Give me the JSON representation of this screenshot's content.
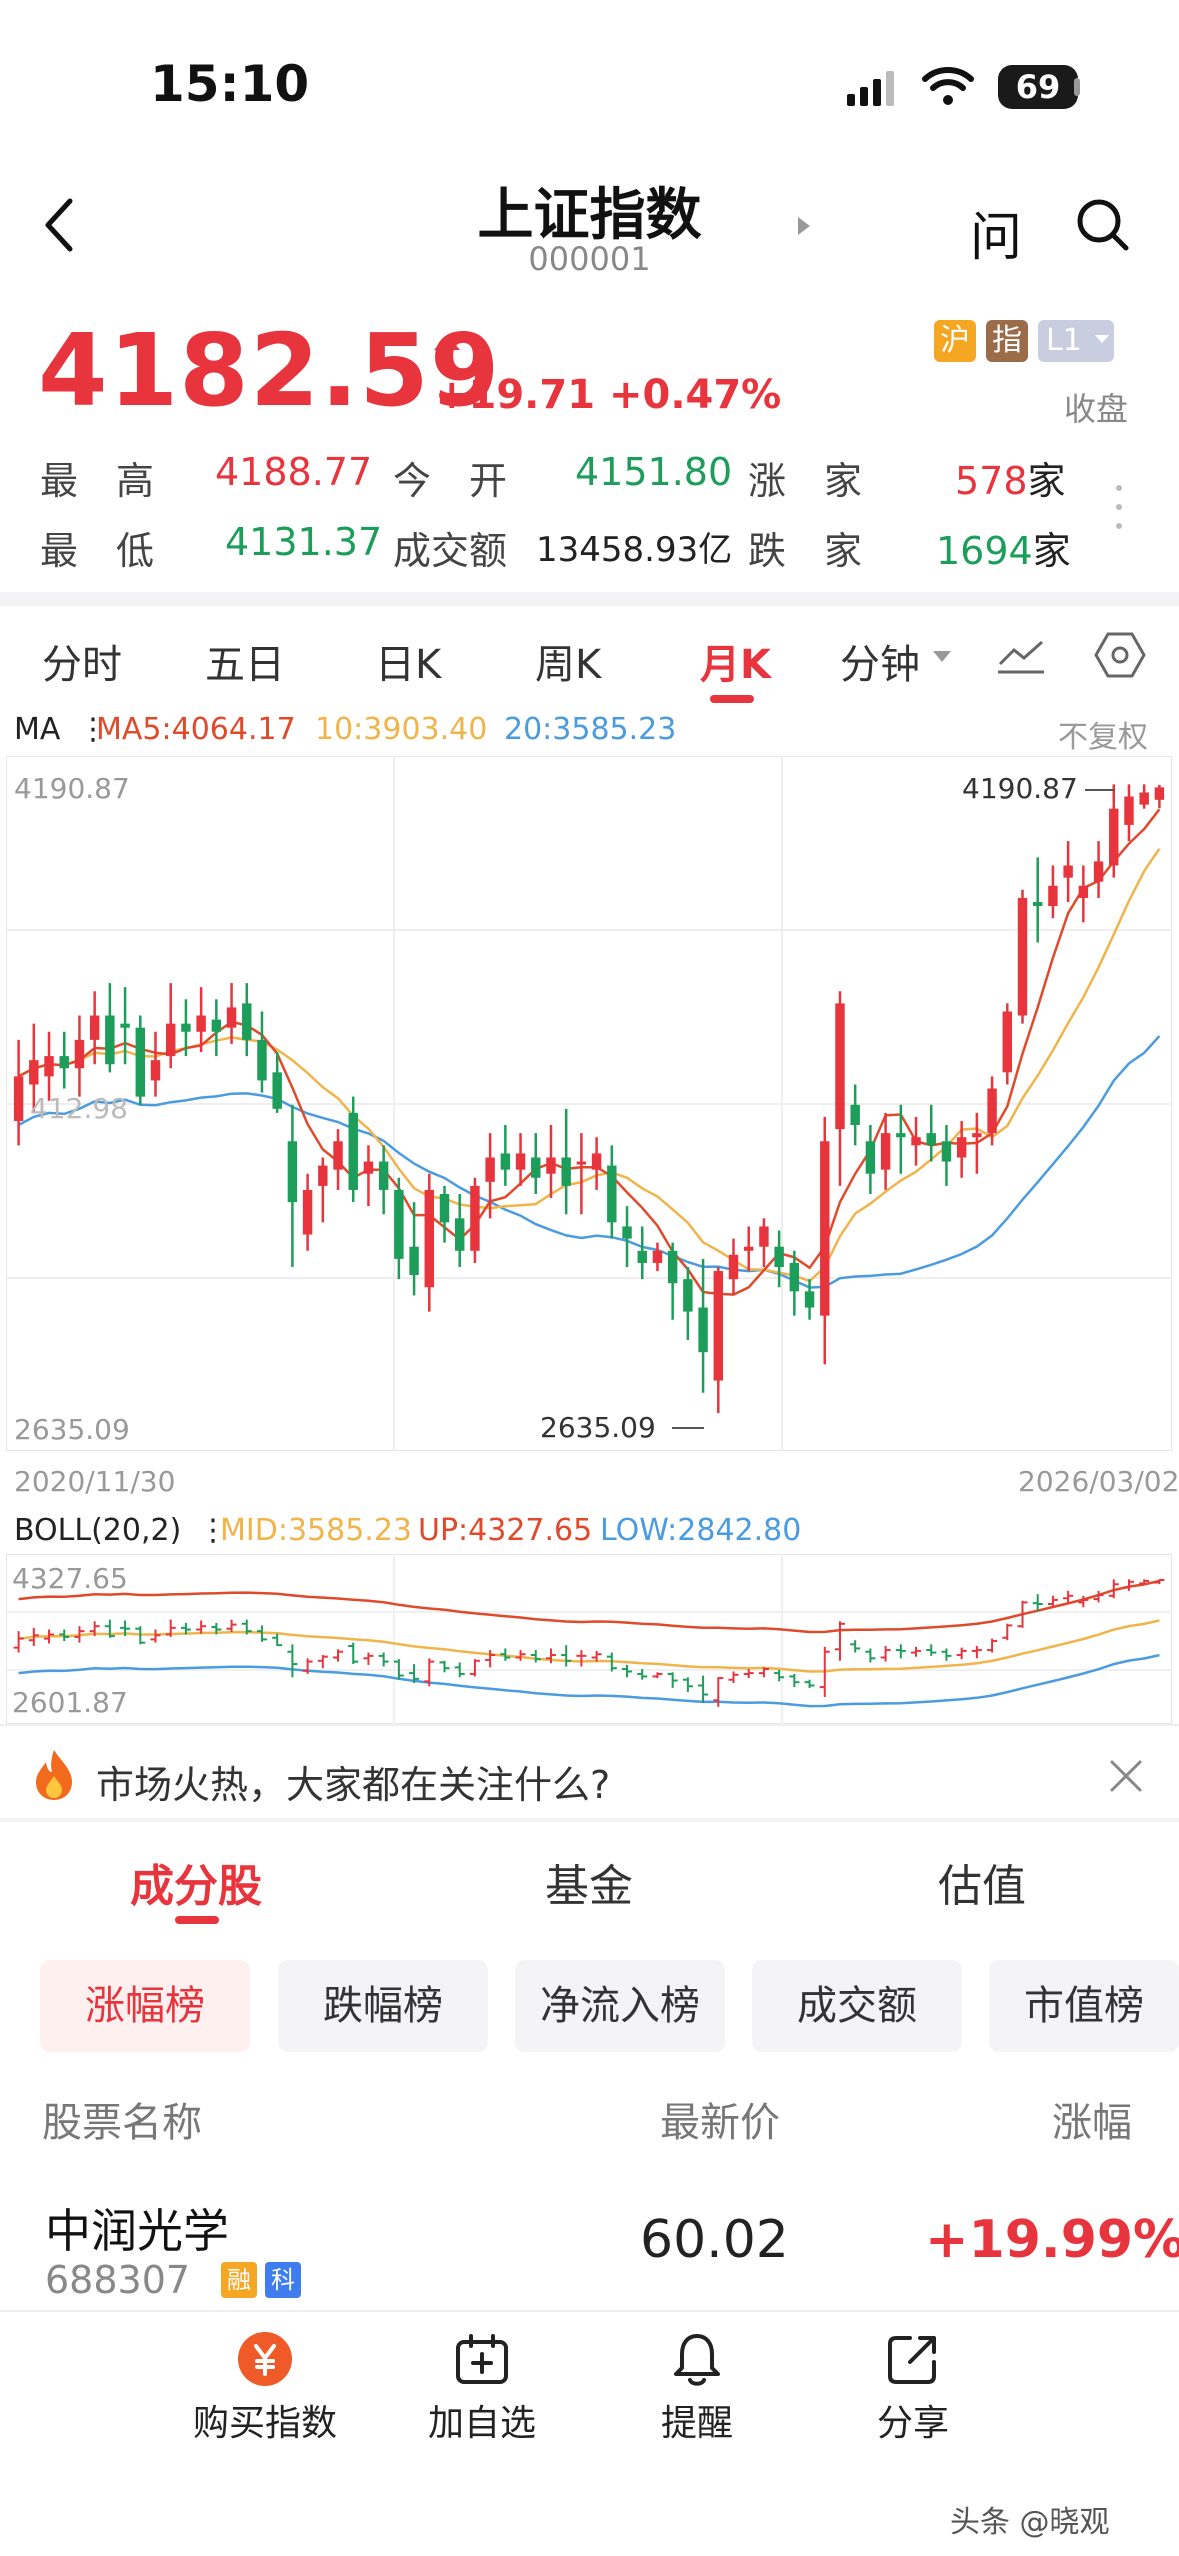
{
  "status": {
    "time": "15:10",
    "battery": "69"
  },
  "header": {
    "title": "上证指数",
    "code": "000001",
    "ask": "问"
  },
  "quote": {
    "price": "4182.59",
    "change": "+19.71 +0.47%",
    "tags": [
      "沪",
      "指",
      "L1"
    ],
    "state": "收盘",
    "stats": [
      {
        "label": "最　高",
        "value": "4188.77",
        "color": "red"
      },
      {
        "label": "今　开",
        "value": "4151.80",
        "color": "green"
      },
      {
        "label": "涨　家",
        "value": "578",
        "unit": "家",
        "color": "red"
      },
      {
        "label": "最　低",
        "value": "4131.37",
        "color": "green"
      },
      {
        "label": "成交额",
        "value": "13458.93亿",
        "color": "plain"
      },
      {
        "label": "跌　家",
        "value": "1694",
        "unit": "家",
        "color": "green"
      }
    ]
  },
  "ktabs": [
    "分时",
    "五日",
    "日K",
    "周K",
    "月K",
    "分钟"
  ],
  "ma": {
    "label": "MA",
    "ma5": "MA5:4064.17",
    "ma10": "10:3903.40",
    "ma20": "20:3585.23",
    "adjust": "不复权"
  },
  "chart_labels": {
    "top": "4190.87",
    "bottom": "2635.09",
    "high_mark": "4190.87",
    "low_mark": "2635.09",
    "mid": "412.98",
    "start_date": "2020/11/30",
    "end_date": "2026/03/02"
  },
  "boll": {
    "label": "BOLL(20,2)",
    "mid": "MID:3585.23",
    "up": "UP:4327.65",
    "low": "LOW:2842.80",
    "top": "4327.65",
    "bottom": "2601.87"
  },
  "colors": {
    "red": "#e8343d",
    "green": "#1c9e5a",
    "ma5": "#e04a2a",
    "ma10": "#f0b44a",
    "ma20": "#4a9be0"
  },
  "chart_data": {
    "type": "candlestick",
    "ylim": [
      2635.09,
      4190.87
    ],
    "candles": [
      [
        3360,
        3470,
        3300,
        3560
      ],
      [
        3450,
        3510,
        3380,
        3600
      ],
      [
        3470,
        3520,
        3410,
        3580
      ],
      [
        3520,
        3490,
        3440,
        3580
      ],
      [
        3490,
        3560,
        3420,
        3620
      ],
      [
        3560,
        3620,
        3500,
        3680
      ],
      [
        3620,
        3500,
        3480,
        3700
      ],
      [
        3600,
        3590,
        3500,
        3690
      ],
      [
        3590,
        3420,
        3400,
        3620
      ],
      [
        3460,
        3510,
        3420,
        3580
      ],
      [
        3520,
        3600,
        3490,
        3700
      ],
      [
        3600,
        3580,
        3520,
        3660
      ],
      [
        3580,
        3620,
        3530,
        3690
      ],
      [
        3610,
        3580,
        3520,
        3660
      ],
      [
        3590,
        3640,
        3550,
        3700
      ],
      [
        3650,
        3560,
        3520,
        3700
      ],
      [
        3560,
        3460,
        3430,
        3630
      ],
      [
        3480,
        3390,
        3380,
        3530
      ],
      [
        3310,
        3160,
        3000,
        3400
      ],
      [
        3080,
        3190,
        3040,
        3230
      ],
      [
        3200,
        3250,
        3110,
        3270
      ],
      [
        3240,
        3310,
        3190,
        3340
      ],
      [
        3380,
        3190,
        3160,
        3420
      ],
      [
        3230,
        3260,
        3150,
        3300
      ],
      [
        3260,
        3190,
        3130,
        3300
      ],
      [
        3190,
        3020,
        2970,
        3220
      ],
      [
        3050,
        2980,
        2930,
        3160
      ],
      [
        2950,
        3190,
        2890,
        3230
      ],
      [
        3180,
        3110,
        3060,
        3200
      ],
      [
        3120,
        3040,
        3000,
        3180
      ],
      [
        3040,
        3200,
        3010,
        3220
      ],
      [
        3210,
        3270,
        3120,
        3330
      ],
      [
        3280,
        3240,
        3200,
        3350
      ],
      [
        3240,
        3280,
        3200,
        3330
      ],
      [
        3270,
        3220,
        3180,
        3330
      ],
      [
        3230,
        3270,
        3170,
        3350
      ],
      [
        3270,
        3200,
        3130,
        3390
      ],
      [
        3260,
        3260,
        3130,
        3330
      ],
      [
        3240,
        3280,
        3190,
        3320
      ],
      [
        3250,
        3110,
        3070,
        3300
      ],
      [
        3100,
        3070,
        3000,
        3150
      ],
      [
        3040,
        3010,
        2970,
        3100
      ],
      [
        3010,
        3040,
        2990,
        3060
      ],
      [
        3040,
        2960,
        2870,
        3060
      ],
      [
        2970,
        2890,
        2820,
        3000
      ],
      [
        2900,
        2790,
        2690,
        3020
      ],
      [
        2720,
        2990,
        2640,
        3000
      ],
      [
        2970,
        3030,
        2930,
        3070
      ],
      [
        3040,
        3050,
        2990,
        3100
      ],
      [
        3050,
        3100,
        3000,
        3120
      ],
      [
        3050,
        3000,
        2950,
        3090
      ],
      [
        3010,
        2940,
        2880,
        3040
      ],
      [
        2940,
        2900,
        2870,
        2970
      ],
      [
        2880,
        3310,
        2760,
        3370
      ],
      [
        3340,
        3650,
        3200,
        3680
      ],
      [
        3400,
        3350,
        3300,
        3450
      ],
      [
        3310,
        3230,
        3180,
        3350
      ],
      [
        3240,
        3330,
        3190,
        3380
      ],
      [
        3330,
        3320,
        3230,
        3400
      ],
      [
        3300,
        3320,
        3250,
        3370
      ],
      [
        3330,
        3300,
        3260,
        3400
      ],
      [
        3310,
        3260,
        3200,
        3350
      ],
      [
        3270,
        3320,
        3220,
        3360
      ],
      [
        3320,
        3330,
        3230,
        3380
      ],
      [
        3330,
        3440,
        3300,
        3470
      ],
      [
        3480,
        3630,
        3450,
        3650
      ],
      [
        3620,
        3910,
        3600,
        3930
      ],
      [
        3900,
        3890,
        3800,
        4010
      ],
      [
        3890,
        3940,
        3860,
        3990
      ],
      [
        3960,
        3990,
        3900,
        4050
      ],
      [
        3910,
        3940,
        3850,
        3990
      ],
      [
        3950,
        4000,
        3910,
        4050
      ],
      [
        3990,
        4130,
        3960,
        4190
      ],
      [
        4090,
        4160,
        4050,
        4190
      ],
      [
        4140,
        4170,
        4130,
        4190
      ],
      [
        4151.8,
        4182.59,
        4131.37,
        4188.77
      ]
    ]
  },
  "hot_banner": "市场火热，大家都在关注什么?",
  "subtabs": [
    "成分股",
    "基金",
    "估值"
  ],
  "chips": [
    "涨幅榜",
    "跌幅榜",
    "净流入榜",
    "成交额",
    "市值榜"
  ],
  "table": {
    "headers": [
      "股票名称",
      "最新价",
      "涨幅"
    ],
    "rows": [
      {
        "name": "中润光学",
        "code": "688307",
        "price": "60.02",
        "pct": "+19.99%",
        "badges": [
          "融",
          "科"
        ]
      }
    ]
  },
  "bottom_bar": [
    "购买指数",
    "加自选",
    "提醒",
    "分享"
  ],
  "watermark": "头条 @晓观"
}
